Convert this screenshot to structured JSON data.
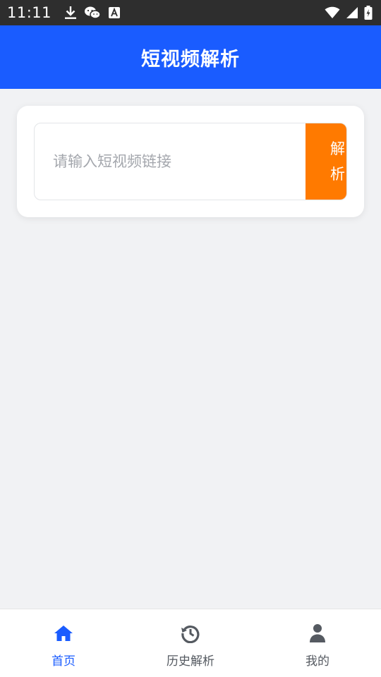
{
  "status_bar": {
    "time": "11:11",
    "left_icons": [
      "download-icon",
      "wechat-icon",
      "text-a-icon"
    ],
    "right_icons": [
      "wifi-icon",
      "cellular-signal-icon",
      "battery-charging-icon"
    ]
  },
  "header": {
    "title": "短视频解析",
    "color": "#1a5cff"
  },
  "search": {
    "placeholder": "请输入短视频链接",
    "value": "",
    "button_label": "解析",
    "button_color": "#ff7a00"
  },
  "bottom_nav": {
    "items": [
      {
        "label": "首页",
        "icon": "home-icon",
        "active": true
      },
      {
        "label": "历史解析",
        "icon": "history-icon",
        "active": false
      },
      {
        "label": "我的",
        "icon": "user-icon",
        "active": false
      }
    ],
    "active_color": "#1a5cff",
    "inactive_color": "#555a61"
  }
}
